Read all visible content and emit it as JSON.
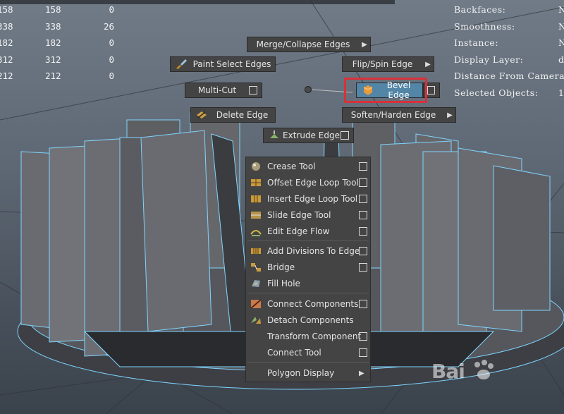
{
  "hud_stats": {
    "rows": [
      [
        "158",
        "158",
        "0"
      ],
      [
        "338",
        "338",
        "26"
      ],
      [
        "182",
        "182",
        "0"
      ],
      [
        "312",
        "312",
        "0"
      ],
      [
        "212",
        "212",
        "0"
      ]
    ]
  },
  "hud_info": {
    "lines": [
      {
        "label": "Backfaces:",
        "value": "N"
      },
      {
        "label": "Smoothness:",
        "value": "N"
      },
      {
        "label": "Instance:",
        "value": "N"
      },
      {
        "label": "Display Layer:",
        "value": "d"
      },
      {
        "label": "Distance From Camera:",
        "value": ""
      },
      {
        "label": "Selected Objects:",
        "value": "1"
      }
    ]
  },
  "marking_menu": {
    "merge_collapse_edges": "Merge/Collapse Edges",
    "paint_select_edges": "Paint Select Edges",
    "flip_spin_edge": "Flip/Spin Edge",
    "multi_cut": "Multi-Cut",
    "bevel_edge": "Bevel Edge",
    "delete_edge": "Delete Edge",
    "soften_harden_edge": "Soften/Harden Edge",
    "extrude_edge": "Extrude Edge"
  },
  "dropdown_menu": {
    "items": [
      {
        "label": "Crease Tool",
        "icon": "crease-icon",
        "option_box": true
      },
      {
        "label": "Offset Edge Loop Tool",
        "icon": "offset-edge-loop-icon",
        "option_box": true
      },
      {
        "label": "Insert Edge Loop Tool",
        "icon": "insert-edge-loop-icon",
        "option_box": true
      },
      {
        "label": "Slide Edge Tool",
        "icon": "slide-edge-icon",
        "option_box": true
      },
      {
        "label": "Edit Edge Flow",
        "icon": "edit-edge-flow-icon",
        "option_box": true
      },
      {
        "label": "Add Divisions To Edge",
        "icon": "add-divisions-icon",
        "option_box": true
      },
      {
        "label": "Bridge",
        "icon": "bridge-icon",
        "option_box": true
      },
      {
        "label": "Fill Hole",
        "icon": "fill-hole-icon",
        "option_box": false
      },
      {
        "label": "Connect Components",
        "icon": "connect-components-icon",
        "option_box": true
      },
      {
        "label": "Detach Components",
        "icon": "detach-components-icon",
        "option_box": false
      },
      {
        "label": "Transform Component",
        "icon": "",
        "option_box": true
      },
      {
        "label": "Connect Tool",
        "icon": "",
        "option_box": true
      },
      {
        "label": "Polygon Display",
        "icon": "",
        "option_box": false,
        "submenu": true
      }
    ]
  },
  "watermark": {
    "text": "Bai"
  },
  "colors": {
    "menu_bg": "#444444",
    "active_item": "#5285a6",
    "highlight_frame": "#d9303a",
    "wire_highlight": "#7fd4ff"
  }
}
